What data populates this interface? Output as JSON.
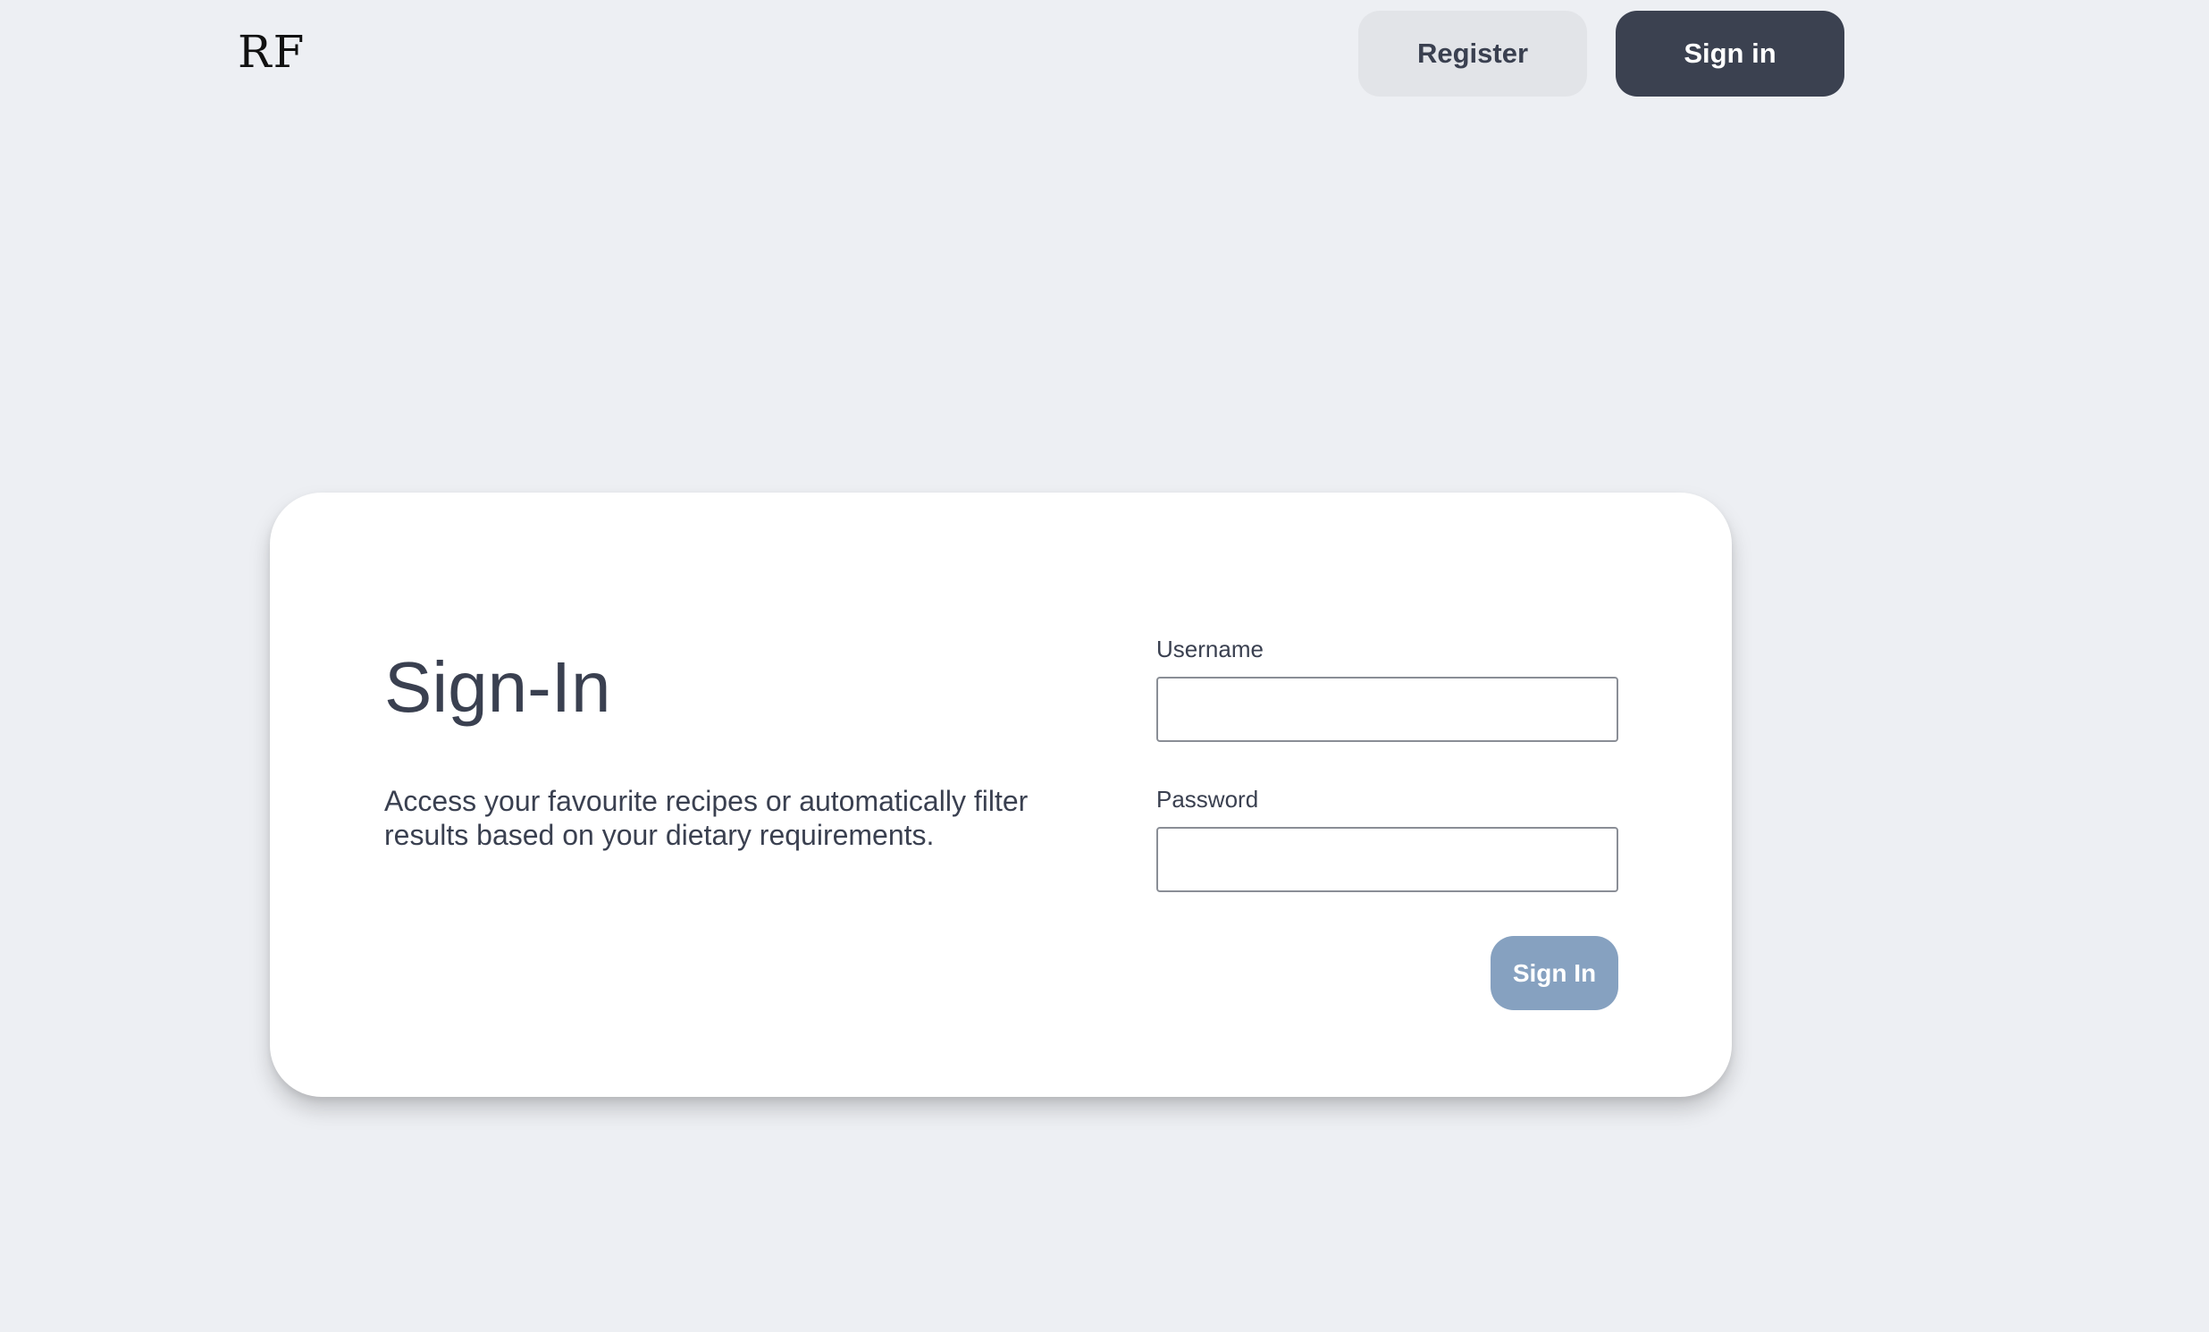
{
  "header": {
    "logo_text": "RF",
    "register_label": "Register",
    "signin_label": "Sign in"
  },
  "signin_card": {
    "title": "Sign-In",
    "description": "Access your favourite recipes or automatically filter results based on your dietary requirements.",
    "username_label": "Username",
    "username_value": "",
    "password_label": "Password",
    "password_value": "",
    "submit_label": "Sign In"
  },
  "colors": {
    "page_background": "#edeff3",
    "card_background": "#ffffff",
    "primary_dark": "#3b4150",
    "secondary_button": "#e2e4e8",
    "submit_button": "#86a1c0",
    "text": "#3a4050"
  }
}
